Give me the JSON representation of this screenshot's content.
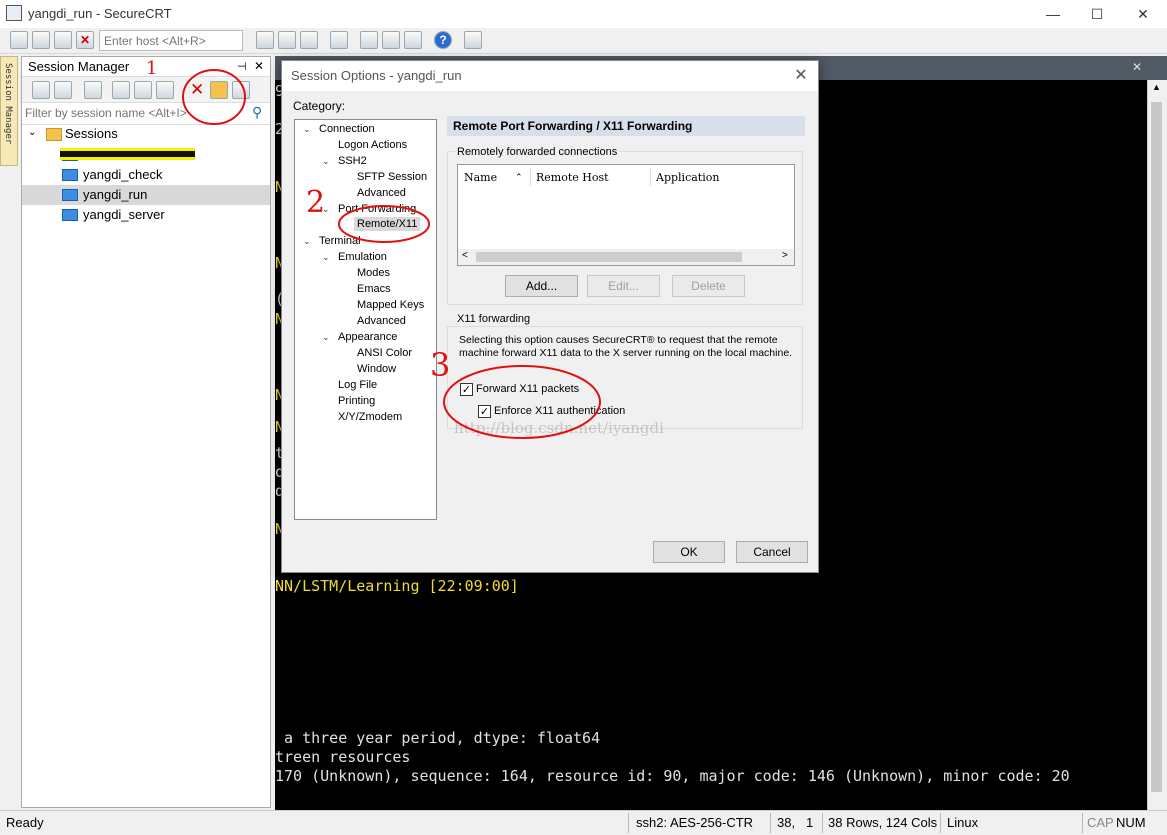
{
  "window": {
    "title": "yangdi_run - SecureCRT",
    "minimize": "—",
    "maximize": "☐",
    "close": "✕"
  },
  "toolbar": {
    "host_placeholder": "Enter host <Alt+R>"
  },
  "side_tab": {
    "label": "Session Manager"
  },
  "session_manager": {
    "title": "Session Manager",
    "pin": "⊣",
    "close": "✕",
    "filter_placeholder": "Filter by session name <Alt+I>",
    "root": "Sessions",
    "items": [
      {
        "label": ""
      },
      {
        "label": "yangdi_check"
      },
      {
        "label": "yangdi_run"
      },
      {
        "label": "yangdi_server"
      }
    ]
  },
  "terminal": {
    "lines": [
      "NN/LSTM/Learning [22:09:00]",
      " a three year period, dtype: float64",
      "treen resources",
      "170 (Unknown), sequence: 164, resource id: 90, major code: 146 (Unknown), minor code: 20"
    ],
    "left_fragments": [
      "9",
      "2",
      "N",
      "N",
      "N",
      "(",
      "N",
      "N",
      "t",
      "o",
      "d",
      "N"
    ]
  },
  "status_bar": {
    "ready": "Ready",
    "cipher": "ssh2: AES-256-CTR",
    "row": "38,",
    "col": "1",
    "size": "38 Rows, 124 Cols",
    "os": "Linux",
    "cap": "CAP",
    "num": "NUM"
  },
  "dialog": {
    "title": "Session Options - yangdi_run",
    "close": "✕",
    "category_label": "Category:",
    "tree": [
      {
        "label": "Connection",
        "expander": "⌄"
      },
      {
        "label": "Logon Actions"
      },
      {
        "label": "SSH2",
        "expander": "⌄"
      },
      {
        "label": "SFTP Session"
      },
      {
        "label": "Advanced"
      },
      {
        "label": "Port Forwarding",
        "expander": "⌄"
      },
      {
        "label": "Remote/X11"
      },
      {
        "label": "Terminal",
        "expander": "⌄"
      },
      {
        "label": "Emulation",
        "expander": "⌄"
      },
      {
        "label": "Modes"
      },
      {
        "label": "Emacs"
      },
      {
        "label": "Mapped Keys"
      },
      {
        "label": "Advanced"
      },
      {
        "label": "Appearance",
        "expander": "⌄"
      },
      {
        "label": "ANSI Color"
      },
      {
        "label": "Window"
      },
      {
        "label": "Log File"
      },
      {
        "label": "Printing"
      },
      {
        "label": "X/Y/Zmodem"
      }
    ],
    "panel_title": "Remote Port Forwarding / X11 Forwarding",
    "remote_group": "Remotely forwarded connections",
    "columns": [
      "Name",
      "Remote Host",
      "Application"
    ],
    "sort_arrow": "⌃",
    "buttons": {
      "add": "Add...",
      "edit": "Edit...",
      "delete": "Delete"
    },
    "x11_group": "X11 forwarding",
    "x11_desc": "Selecting this option causes SecureCRT® to request that the remote machine forward X11 data to the X server running on the local machine.",
    "forward_x11": {
      "label": "Forward X11 packets",
      "checked": "✓"
    },
    "enforce_auth": {
      "label": "Enforce X11 authentication",
      "checked": "✓"
    },
    "ok": "OK",
    "cancel": "Cancel",
    "watermark": "http://blog.csdn.net/iyangdi"
  },
  "annotations": {
    "one": "1",
    "two": "2",
    "three": "3"
  },
  "colors": {
    "terminal_yellow": "#f0e030",
    "annotation_red": "#e01010",
    "panel_head": "#d6dfea"
  }
}
